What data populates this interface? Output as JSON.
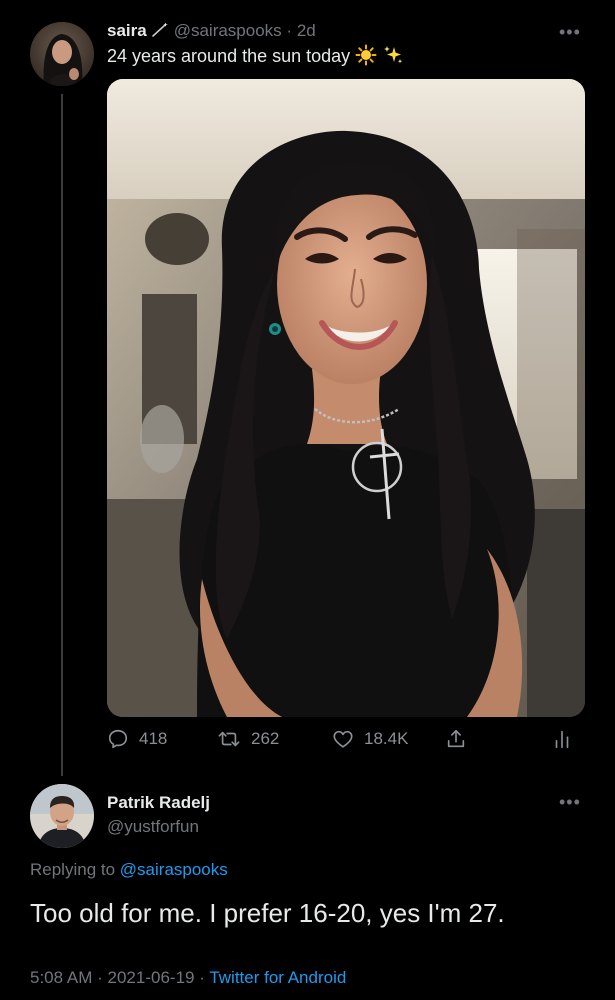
{
  "tweet": {
    "display_name": "saira",
    "handle": "@sairaspooks",
    "separator": "·",
    "time_ago": "2d",
    "text": "24 years around the sun today",
    "emojis": [
      "sun-emoji",
      "sparkles-emoji"
    ],
    "more_label": "•••",
    "stats": {
      "replies": "418",
      "retweets": "262",
      "likes": "18.4K"
    }
  },
  "reply": {
    "display_name": "Patrik Radelj",
    "handle": "@yustforfun",
    "more_label": "•••",
    "replying_prefix": "Replying to",
    "replying_to": "@sairaspooks",
    "text": "Too old for me. I prefer 16-20, yes I'm 27.",
    "time": "5:08 AM",
    "separator": "·",
    "date": "2021-06-19",
    "separator2": "·",
    "source": "Twitter for Android"
  },
  "colors": {
    "background": "#000000",
    "text_primary": "#e7e9ea",
    "text_secondary": "#71767b",
    "link": "#1d9bf0",
    "thread_line": "#3a3d40"
  }
}
